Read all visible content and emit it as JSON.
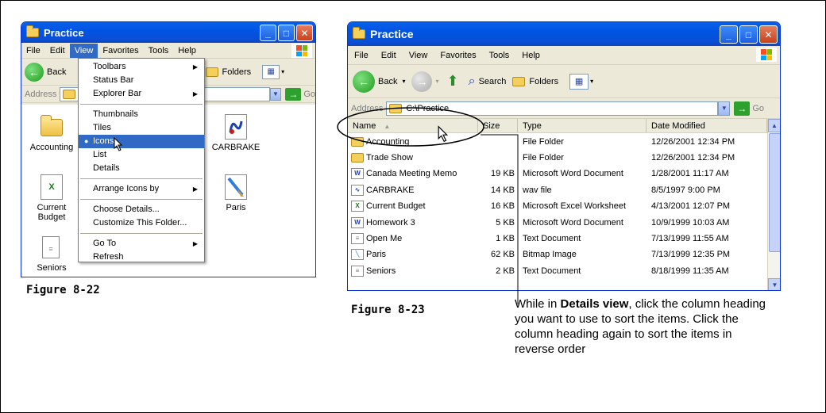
{
  "figure1": {
    "title": "Practice",
    "caption": "Figure 8-22",
    "menubar": [
      "File",
      "Edit",
      "View",
      "Favorites",
      "Tools",
      "Help"
    ],
    "toolbar": {
      "back": "Back",
      "folders": "Folders"
    },
    "address_label": "Address",
    "go": "Go",
    "icons": [
      {
        "label": "Accounting",
        "icon": "folder-icon"
      },
      {
        "label": "CARBRAKE",
        "icon": "wav-file-icon"
      },
      {
        "label": "Current Budget",
        "icon": "excel-file-icon"
      },
      {
        "label": "Paris",
        "icon": "bitmap-file-icon"
      },
      {
        "label": "Seniors",
        "icon": "text-file-icon"
      }
    ],
    "view_menu": {
      "items": [
        {
          "label": "Toolbars",
          "submenu": true
        },
        {
          "label": "Status Bar"
        },
        {
          "label": "Explorer Bar",
          "submenu": true
        },
        {
          "sep": true
        },
        {
          "label": "Thumbnails"
        },
        {
          "label": "Tiles"
        },
        {
          "label": "Icons",
          "selected": true,
          "bullet": true
        },
        {
          "label": "List"
        },
        {
          "label": "Details"
        },
        {
          "sep": true
        },
        {
          "label": "Arrange Icons by",
          "submenu": true
        },
        {
          "sep": true
        },
        {
          "label": "Choose Details..."
        },
        {
          "label": "Customize This Folder..."
        },
        {
          "sep": true
        },
        {
          "label": "Go To",
          "submenu": true
        },
        {
          "label": "Refresh"
        }
      ]
    }
  },
  "figure2": {
    "title": "Practice",
    "caption": "Figure 8-23",
    "menubar": [
      "File",
      "Edit",
      "View",
      "Favorites",
      "Tools",
      "Help"
    ],
    "toolbar": {
      "back": "Back",
      "search": "Search",
      "folders": "Folders"
    },
    "address_label": "Address",
    "address_value": "C:\\Practice",
    "go": "Go",
    "columns": [
      "Name",
      "Size",
      "Type",
      "Date Modified"
    ],
    "rows": [
      {
        "name": "Accounting",
        "size": "",
        "type": "File Folder",
        "date": "12/26/2001 12:34 PM",
        "icon": "folder-icon"
      },
      {
        "name": "Trade Show",
        "size": "",
        "type": "File Folder",
        "date": "12/26/2001 12:34 PM",
        "icon": "folder-icon"
      },
      {
        "name": "Canada Meeting Memo",
        "size": "19 KB",
        "type": "Microsoft Word Document",
        "date": "1/28/2001 11:17 AM",
        "icon": "word-doc-icon"
      },
      {
        "name": "CARBRAKE",
        "size": "14 KB",
        "type": "wav file",
        "date": "8/5/1997 9:00 PM",
        "icon": "wav-file-icon"
      },
      {
        "name": "Current Budget",
        "size": "16 KB",
        "type": "Microsoft Excel Worksheet",
        "date": "4/13/2001 12:07 PM",
        "icon": "excel-file-icon"
      },
      {
        "name": "Homework 3",
        "size": "5 KB",
        "type": "Microsoft Word Document",
        "date": "10/9/1999 10:03 AM",
        "icon": "word-doc-icon"
      },
      {
        "name": "Open Me",
        "size": "1 KB",
        "type": "Text Document",
        "date": "7/13/1999 11:55 AM",
        "icon": "text-file-icon"
      },
      {
        "name": "Paris",
        "size": "62 KB",
        "type": "Bitmap Image",
        "date": "7/13/1999 12:35 PM",
        "icon": "bitmap-file-icon"
      },
      {
        "name": "Seniors",
        "size": "2 KB",
        "type": "Text Document",
        "date": "8/18/1999 11:35 AM",
        "icon": "text-file-icon"
      }
    ]
  },
  "note": {
    "pre": "While in ",
    "bold": "Details view",
    "post": ", click the column heading you want to use to sort the items. Click the column heading again to sort the items in reverse order"
  },
  "colors": {
    "xp_blue": "#0054e3",
    "menu_highlight": "#316ac5",
    "window_face": "#ece9d8"
  }
}
